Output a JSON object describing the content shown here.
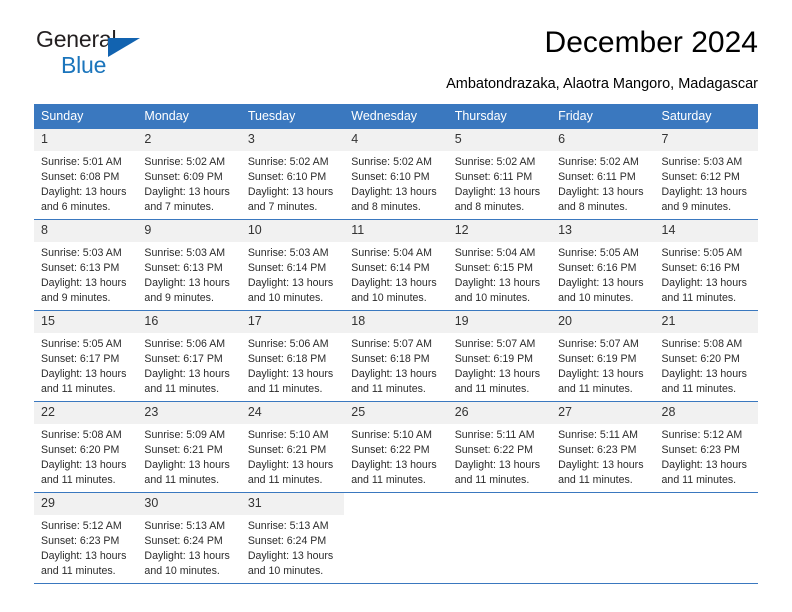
{
  "brand": {
    "name_part1": "General",
    "name_part2": "Blue",
    "triangle_icon": "triangle-icon",
    "color_dark": "#231f20",
    "color_blue": "#1b75bc"
  },
  "header": {
    "title": "December 2024",
    "subtitle": "Ambatondrazaka, Alaotra Mangoro, Madagascar"
  },
  "theme": {
    "header_bg": "#3a78bf",
    "header_text": "#ffffff",
    "daynum_bg": "#f1f1f1",
    "grid_line": "#3a78bf"
  },
  "calendar": {
    "weekday_headers": [
      "Sunday",
      "Monday",
      "Tuesday",
      "Wednesday",
      "Thursday",
      "Friday",
      "Saturday"
    ],
    "weeks": [
      [
        {
          "day": "1",
          "sunrise": "Sunrise: 5:01 AM",
          "sunset": "Sunset: 6:08 PM",
          "daylight_line1": "Daylight: 13 hours",
          "daylight_line2": "and 6 minutes."
        },
        {
          "day": "2",
          "sunrise": "Sunrise: 5:02 AM",
          "sunset": "Sunset: 6:09 PM",
          "daylight_line1": "Daylight: 13 hours",
          "daylight_line2": "and 7 minutes."
        },
        {
          "day": "3",
          "sunrise": "Sunrise: 5:02 AM",
          "sunset": "Sunset: 6:10 PM",
          "daylight_line1": "Daylight: 13 hours",
          "daylight_line2": "and 7 minutes."
        },
        {
          "day": "4",
          "sunrise": "Sunrise: 5:02 AM",
          "sunset": "Sunset: 6:10 PM",
          "daylight_line1": "Daylight: 13 hours",
          "daylight_line2": "and 8 minutes."
        },
        {
          "day": "5",
          "sunrise": "Sunrise: 5:02 AM",
          "sunset": "Sunset: 6:11 PM",
          "daylight_line1": "Daylight: 13 hours",
          "daylight_line2": "and 8 minutes."
        },
        {
          "day": "6",
          "sunrise": "Sunrise: 5:02 AM",
          "sunset": "Sunset: 6:11 PM",
          "daylight_line1": "Daylight: 13 hours",
          "daylight_line2": "and 8 minutes."
        },
        {
          "day": "7",
          "sunrise": "Sunrise: 5:03 AM",
          "sunset": "Sunset: 6:12 PM",
          "daylight_line1": "Daylight: 13 hours",
          "daylight_line2": "and 9 minutes."
        }
      ],
      [
        {
          "day": "8",
          "sunrise": "Sunrise: 5:03 AM",
          "sunset": "Sunset: 6:13 PM",
          "daylight_line1": "Daylight: 13 hours",
          "daylight_line2": "and 9 minutes."
        },
        {
          "day": "9",
          "sunrise": "Sunrise: 5:03 AM",
          "sunset": "Sunset: 6:13 PM",
          "daylight_line1": "Daylight: 13 hours",
          "daylight_line2": "and 9 minutes."
        },
        {
          "day": "10",
          "sunrise": "Sunrise: 5:03 AM",
          "sunset": "Sunset: 6:14 PM",
          "daylight_line1": "Daylight: 13 hours",
          "daylight_line2": "and 10 minutes."
        },
        {
          "day": "11",
          "sunrise": "Sunrise: 5:04 AM",
          "sunset": "Sunset: 6:14 PM",
          "daylight_line1": "Daylight: 13 hours",
          "daylight_line2": "and 10 minutes."
        },
        {
          "day": "12",
          "sunrise": "Sunrise: 5:04 AM",
          "sunset": "Sunset: 6:15 PM",
          "daylight_line1": "Daylight: 13 hours",
          "daylight_line2": "and 10 minutes."
        },
        {
          "day": "13",
          "sunrise": "Sunrise: 5:05 AM",
          "sunset": "Sunset: 6:16 PM",
          "daylight_line1": "Daylight: 13 hours",
          "daylight_line2": "and 10 minutes."
        },
        {
          "day": "14",
          "sunrise": "Sunrise: 5:05 AM",
          "sunset": "Sunset: 6:16 PM",
          "daylight_line1": "Daylight: 13 hours",
          "daylight_line2": "and 11 minutes."
        }
      ],
      [
        {
          "day": "15",
          "sunrise": "Sunrise: 5:05 AM",
          "sunset": "Sunset: 6:17 PM",
          "daylight_line1": "Daylight: 13 hours",
          "daylight_line2": "and 11 minutes."
        },
        {
          "day": "16",
          "sunrise": "Sunrise: 5:06 AM",
          "sunset": "Sunset: 6:17 PM",
          "daylight_line1": "Daylight: 13 hours",
          "daylight_line2": "and 11 minutes."
        },
        {
          "day": "17",
          "sunrise": "Sunrise: 5:06 AM",
          "sunset": "Sunset: 6:18 PM",
          "daylight_line1": "Daylight: 13 hours",
          "daylight_line2": "and 11 minutes."
        },
        {
          "day": "18",
          "sunrise": "Sunrise: 5:07 AM",
          "sunset": "Sunset: 6:18 PM",
          "daylight_line1": "Daylight: 13 hours",
          "daylight_line2": "and 11 minutes."
        },
        {
          "day": "19",
          "sunrise": "Sunrise: 5:07 AM",
          "sunset": "Sunset: 6:19 PM",
          "daylight_line1": "Daylight: 13 hours",
          "daylight_line2": "and 11 minutes."
        },
        {
          "day": "20",
          "sunrise": "Sunrise: 5:07 AM",
          "sunset": "Sunset: 6:19 PM",
          "daylight_line1": "Daylight: 13 hours",
          "daylight_line2": "and 11 minutes."
        },
        {
          "day": "21",
          "sunrise": "Sunrise: 5:08 AM",
          "sunset": "Sunset: 6:20 PM",
          "daylight_line1": "Daylight: 13 hours",
          "daylight_line2": "and 11 minutes."
        }
      ],
      [
        {
          "day": "22",
          "sunrise": "Sunrise: 5:08 AM",
          "sunset": "Sunset: 6:20 PM",
          "daylight_line1": "Daylight: 13 hours",
          "daylight_line2": "and 11 minutes."
        },
        {
          "day": "23",
          "sunrise": "Sunrise: 5:09 AM",
          "sunset": "Sunset: 6:21 PM",
          "daylight_line1": "Daylight: 13 hours",
          "daylight_line2": "and 11 minutes."
        },
        {
          "day": "24",
          "sunrise": "Sunrise: 5:10 AM",
          "sunset": "Sunset: 6:21 PM",
          "daylight_line1": "Daylight: 13 hours",
          "daylight_line2": "and 11 minutes."
        },
        {
          "day": "25",
          "sunrise": "Sunrise: 5:10 AM",
          "sunset": "Sunset: 6:22 PM",
          "daylight_line1": "Daylight: 13 hours",
          "daylight_line2": "and 11 minutes."
        },
        {
          "day": "26",
          "sunrise": "Sunrise: 5:11 AM",
          "sunset": "Sunset: 6:22 PM",
          "daylight_line1": "Daylight: 13 hours",
          "daylight_line2": "and 11 minutes."
        },
        {
          "day": "27",
          "sunrise": "Sunrise: 5:11 AM",
          "sunset": "Sunset: 6:23 PM",
          "daylight_line1": "Daylight: 13 hours",
          "daylight_line2": "and 11 minutes."
        },
        {
          "day": "28",
          "sunrise": "Sunrise: 5:12 AM",
          "sunset": "Sunset: 6:23 PM",
          "daylight_line1": "Daylight: 13 hours",
          "daylight_line2": "and 11 minutes."
        }
      ],
      [
        {
          "day": "29",
          "sunrise": "Sunrise: 5:12 AM",
          "sunset": "Sunset: 6:23 PM",
          "daylight_line1": "Daylight: 13 hours",
          "daylight_line2": "and 11 minutes."
        },
        {
          "day": "30",
          "sunrise": "Sunrise: 5:13 AM",
          "sunset": "Sunset: 6:24 PM",
          "daylight_line1": "Daylight: 13 hours",
          "daylight_line2": "and 10 minutes."
        },
        {
          "day": "31",
          "sunrise": "Sunrise: 5:13 AM",
          "sunset": "Sunset: 6:24 PM",
          "daylight_line1": "Daylight: 13 hours",
          "daylight_line2": "and 10 minutes."
        },
        null,
        null,
        null,
        null
      ]
    ]
  }
}
